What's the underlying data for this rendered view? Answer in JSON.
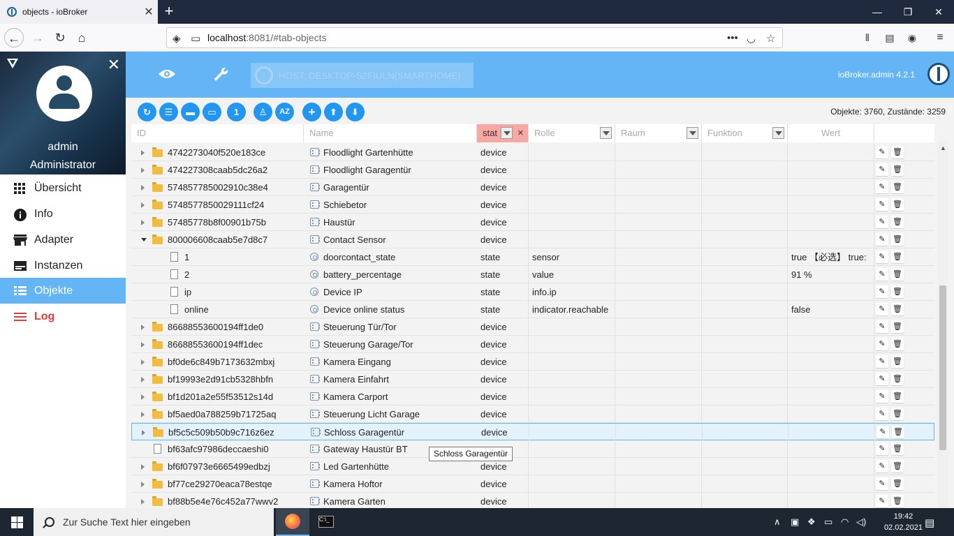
{
  "browser": {
    "tab_title": "objects - ioBroker",
    "url_host": "localhost",
    "url_rest": ":8081/#tab-objects"
  },
  "sidebar": {
    "user_name": "admin",
    "user_role": "Administrator",
    "items": [
      {
        "label": "Übersicht",
        "icon": "grid-icon"
      },
      {
        "label": "Info",
        "icon": "info-icon"
      },
      {
        "label": "Adapter",
        "icon": "store-icon"
      },
      {
        "label": "Instanzen",
        "icon": "instances-icon"
      },
      {
        "label": "Objekte",
        "icon": "list-icon"
      },
      {
        "label": "Log",
        "icon": "log-icon"
      }
    ],
    "active": "Objekte"
  },
  "appbar": {
    "host": "HOST: DESKTOP-S2FIULN(SMARTHOME)",
    "version": "ioBroker.admin 4.2.1"
  },
  "toolbar": {
    "counts": "Objekte: 3760, Zustände: 3259"
  },
  "columns": {
    "id": "ID",
    "name": "Name",
    "type": "stat",
    "role": "Rolle",
    "room": "Raum",
    "function": "Funktion",
    "value": "Wert"
  },
  "rows": [
    {
      "id": "4742273040f520e183ce",
      "name": "Floodlight Gartenhütte",
      "type": "device",
      "role": "",
      "value": "",
      "kind": "folder"
    },
    {
      "id": "474227308caab5dc26a2",
      "name": "Floodlight Garagentür",
      "type": "device",
      "role": "",
      "value": "",
      "kind": "folder"
    },
    {
      "id": "574857785002910c38e4",
      "name": "Garagentür",
      "type": "device",
      "role": "",
      "value": "",
      "kind": "folder"
    },
    {
      "id": "5748577850029111cf24",
      "name": "Schiebetor",
      "type": "device",
      "role": "",
      "value": "",
      "kind": "folder"
    },
    {
      "id": "57485778b8f00901b75b",
      "name": "Haustür",
      "type": "device",
      "role": "",
      "value": "",
      "kind": "folder"
    },
    {
      "id": "800006608caab5e7d8c7",
      "name": "Contact Sensor",
      "type": "device",
      "role": "",
      "value": "",
      "kind": "folder-open"
    },
    {
      "id": "1",
      "name": "doorcontact_state",
      "type": "state",
      "role": "sensor",
      "value": "true 【必选】 true:",
      "kind": "file"
    },
    {
      "id": "2",
      "name": "battery_percentage",
      "type": "state",
      "role": "value",
      "value": "91 %",
      "kind": "file"
    },
    {
      "id": "ip",
      "name": "Device IP",
      "type": "state",
      "role": "info.ip",
      "value": "",
      "kind": "file"
    },
    {
      "id": "online",
      "name": "Device online status",
      "type": "state",
      "role": "indicator.reachable",
      "value": "false",
      "kind": "file"
    },
    {
      "id": "86688553600194ff1de0",
      "name": "Steuerung Tür/Tor",
      "type": "device",
      "role": "",
      "value": "",
      "kind": "folder"
    },
    {
      "id": "86688553600194ff1dec",
      "name": "Steuerung Garage/Tor",
      "type": "device",
      "role": "",
      "value": "",
      "kind": "folder"
    },
    {
      "id": "bf0de6c849b7173632mbxj",
      "name": "Kamera Eingang",
      "type": "device",
      "role": "",
      "value": "",
      "kind": "folder"
    },
    {
      "id": "bf19993e2d91cb5328hbfn",
      "name": "Kamera Einfahrt",
      "type": "device",
      "role": "",
      "value": "",
      "kind": "folder"
    },
    {
      "id": "bf1d201a2e55f53512s14d",
      "name": "Kamera Carport",
      "type": "device",
      "role": "",
      "value": "",
      "kind": "folder"
    },
    {
      "id": "bf5aed0a788259b71725aq",
      "name": "Steuerung Licht Garage",
      "type": "device",
      "role": "",
      "value": "",
      "kind": "folder"
    },
    {
      "id": "bf5c5c509b50b9c716z6ez",
      "name": "Schloss Garagentür",
      "type": "device",
      "role": "",
      "value": "",
      "kind": "folder",
      "selected": true
    },
    {
      "id": "bf63afc97986deccaeshi0",
      "name": "Gateway Haustür BT",
      "type": "",
      "role": "",
      "value": "",
      "kind": "root-file"
    },
    {
      "id": "bf6f07973e6665499edbzj",
      "name": "Led Gartenhütte",
      "type": "device",
      "role": "",
      "value": "",
      "kind": "folder"
    },
    {
      "id": "bf77ce29270eaca78estqe",
      "name": "Kamera Hoftor",
      "type": "device",
      "role": "",
      "value": "",
      "kind": "folder"
    },
    {
      "id": "bf88b5e4e76c452a77wwv2",
      "name": "Kamera Garten",
      "type": "device",
      "role": "",
      "value": "",
      "kind": "folder"
    }
  ],
  "tooltip": "Schloss Garagentür",
  "taskbar": {
    "search_placeholder": "Zur Suche Text hier eingeben",
    "time": "19:42",
    "date": "02.02.2021"
  }
}
